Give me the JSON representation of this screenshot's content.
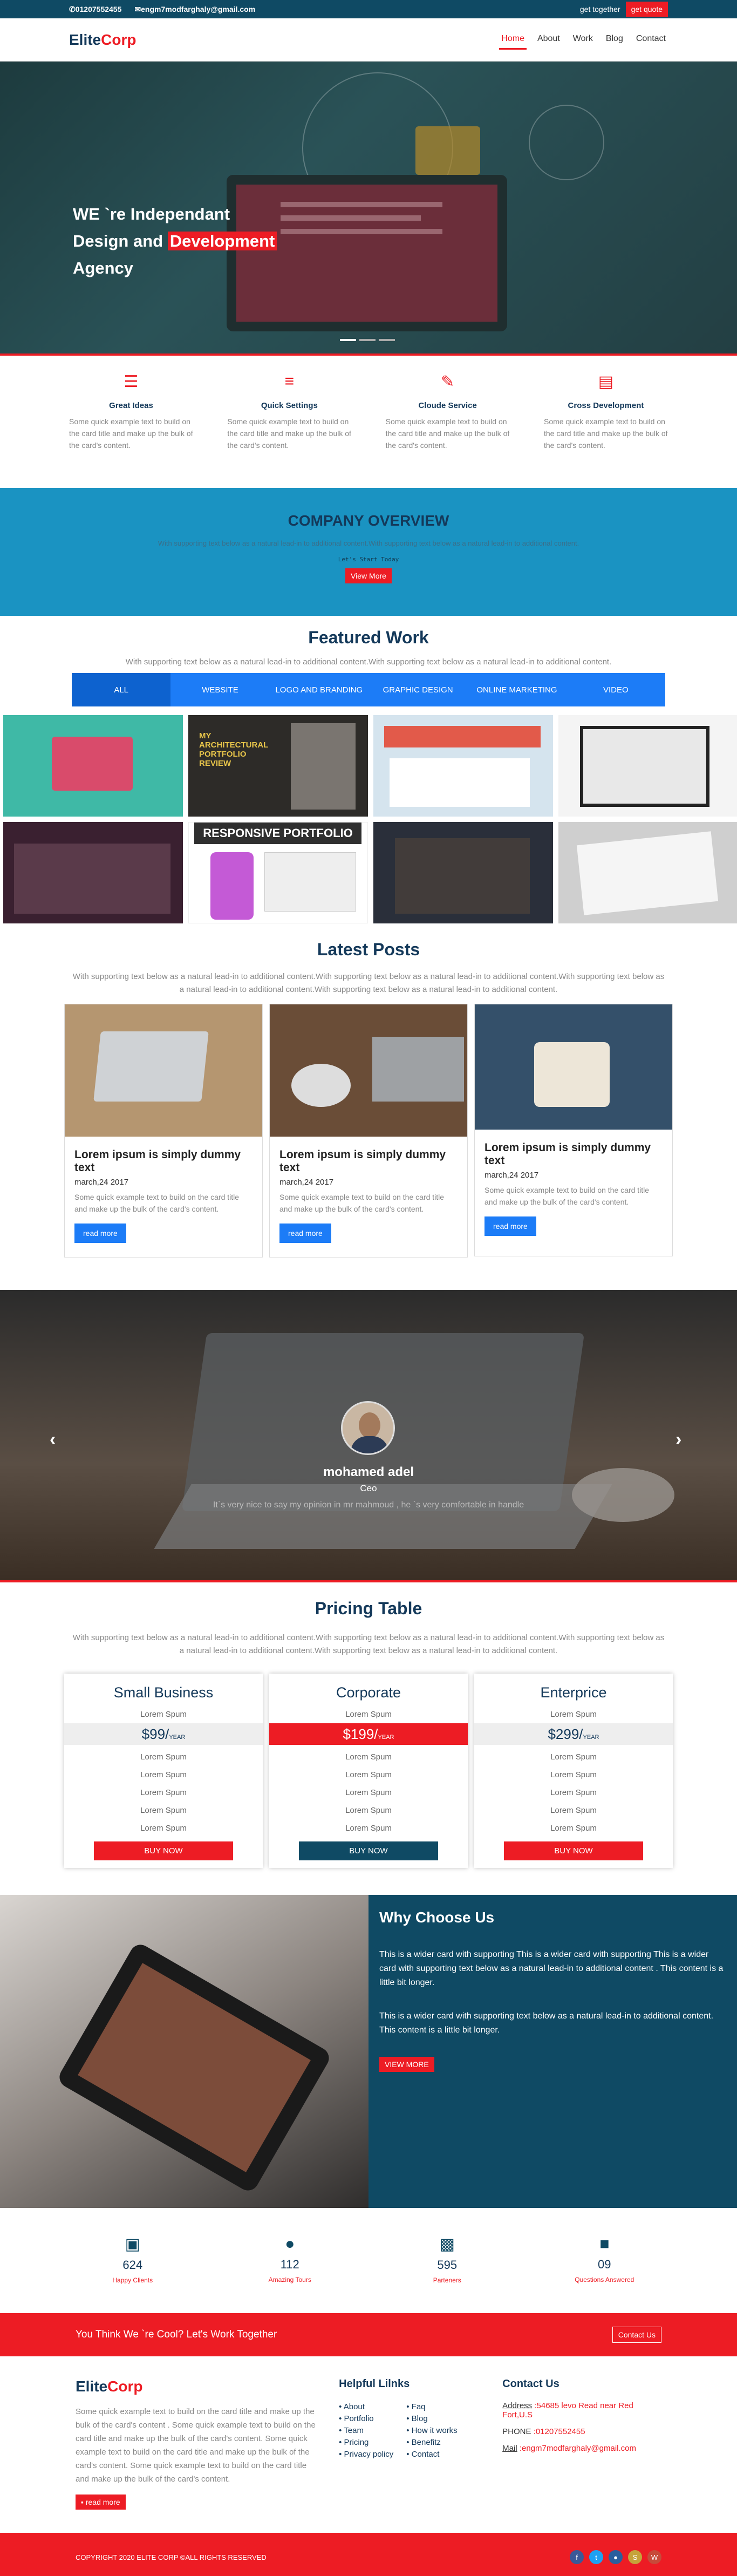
{
  "topbar": {
    "phone": "01207552455",
    "email": "engm7modfarghaly@gmail.com",
    "get_together": "get together",
    "get_quote": "get quote"
  },
  "nav": {
    "logo_a": "Elite",
    "logo_b": "Corp",
    "items": [
      "Home",
      "About",
      "Work",
      "Blog",
      "Contact"
    ]
  },
  "hero": {
    "line1": "WE `re Independant",
    "line2a": "Design and ",
    "line2b": "Development",
    "line3": "Agency"
  },
  "features": [
    {
      "title": "Great Ideas",
      "text": "Some quick example text to build on the card title and make up the bulk of the card's content."
    },
    {
      "title": "Quick Settings",
      "text": "Some quick example text to build on the card title and make up the bulk of the card's content."
    },
    {
      "title": "Cloude Service",
      "text": "Some quick example text to build on the card title and make up the bulk of the card's content."
    },
    {
      "title": "Cross Development",
      "text": "Some quick example text to build on the card title and make up the bulk of the card's content."
    }
  ],
  "overview": {
    "title": "COMPANY OVERVIEW",
    "text": "With supporting text below as a natural lead-in to additional content.With supporting text below as a natural lead-in to additional content.",
    "small": "Let's Start Today",
    "button": "View More"
  },
  "featured": {
    "title": "Featured Work",
    "sub": "With supporting text below as a natural lead-in to additional content.With supporting text below as a natural lead-in to additional content.",
    "tabs": [
      "ALL",
      "WEBSITE",
      "LOGO AND BRANDING",
      "GRAPHIC DESIGN",
      "ONLINE MARKETING",
      "VIDEO"
    ],
    "tile_captions": [
      "MY ARCHITECTURAL PORTFOLIO REVIEW",
      "RESPONSIVE PORTFOLIO"
    ]
  },
  "posts": {
    "title": "Latest Posts",
    "sub": "With supporting text below as a natural lead-in to additional content.With supporting text below as a natural lead-in to additional content.With supporting text below as a natural lead-in to additional content.With supporting text below as a natural lead-in to additional content.",
    "items": [
      {
        "title": "Lorem ipsum is simply dummy text",
        "date": "march,24 2017",
        "text": "Some quick example text to build on the card title and make up the bulk of the card's content.",
        "button": "read more"
      },
      {
        "title": "Lorem ipsum is simply dummy text",
        "date": "march,24 2017",
        "text": "Some quick example text to build on the card title and make up the bulk of the card's content.",
        "button": "read more"
      },
      {
        "title": "Lorem ipsum is simply dummy text",
        "date": "march,24 2017",
        "text": "Some quick example text to build on the card title and make up the bulk of the card's content.",
        "button": "read more"
      }
    ]
  },
  "testimonial": {
    "name": "mohamed adel",
    "role": "Ceo",
    "quote": "It`s very nice to say my opinion in mr mahmoud , he `s very comfortable in handle"
  },
  "pricing": {
    "title": "Pricing Table",
    "sub": "With supporting text below as a natural lead-in to additional content.With supporting text below as a natural lead-in to additional content.With supporting text below as a natural lead-in to additional content.With supporting text below as a natural lead-in to additional content.",
    "plans": [
      {
        "name": "Small Business",
        "price": "$99/",
        "per": "YEAR",
        "top": "Lorem Spum",
        "rows": [
          "Lorem Spum",
          "Lorem Spum",
          "Lorem Spum",
          "Lorem Spum",
          "Lorem Spum"
        ],
        "button": "BUY NOW"
      },
      {
        "name": "Corporate",
        "price": "$199/",
        "per": "YEAR",
        "top": "Lorem Spum",
        "rows": [
          "Lorem Spum",
          "Lorem Spum",
          "Lorem Spum",
          "Lorem Spum",
          "Lorem Spum"
        ],
        "button": "BUY NOW"
      },
      {
        "name": "Enterprice",
        "price": "$299/",
        "per": "YEAR",
        "top": "Lorem Spum",
        "rows": [
          "Lorem Spum",
          "Lorem Spum",
          "Lorem Spum",
          "Lorem Spum",
          "Lorem Spum"
        ],
        "button": "BUY NOW"
      }
    ]
  },
  "why": {
    "title": "Why Choose Us",
    "p1": "This is a wider card with supporting This is a wider card with supporting This is a wider card with supporting text below as a natural lead-in to additional content . This content is a little bit longer.",
    "p2": "This is a wider card with supporting text below as a natural lead-in to additional content. This content is a little bit longer.",
    "button": "VIEW MORE"
  },
  "stats": [
    {
      "n": "624",
      "l": "Happy Clients"
    },
    {
      "n": "112",
      "l": "Amazing Tours"
    },
    {
      "n": "595",
      "l": "Parteners"
    },
    {
      "n": "09",
      "l": "Questions Answered"
    }
  ],
  "cta": {
    "text": "You Think We `re Cool? Let's Work Together",
    "button": "Contact Us"
  },
  "footer": {
    "logo_a": "Elite",
    "logo_b": "Corp",
    "about": "Some quick example text to build on the card title and make up the bulk of the card's content . Some quick example text to build on the card title and make up the bulk of the card's content. Some quick example text to build on the card title and make up the bulk of the card's content. Some quick example text to build on the card title and make up the bulk of the card's content.",
    "read_more": "read more",
    "links_title": "Helpful Lilnks",
    "links1": [
      "About",
      "Portfolio",
      "Team",
      "Pricing",
      "Privacy policy"
    ],
    "links2": [
      "Faq",
      "Blog",
      "How it works",
      "Benefitz",
      "Contact"
    ],
    "contact_title": "Contact Us",
    "address_label": "Address",
    "address": " :54685 levo Read near Red Fort,U.S",
    "phone_label": "PHONE",
    "phone": " :01207552455",
    "mail_label": "Mail",
    "mail": " :engm7modfarghaly@gmail.com",
    "copyright": "COPYRIGHT 2020 ELITE CORP ©ALL RIGHTS RESERVED"
  }
}
